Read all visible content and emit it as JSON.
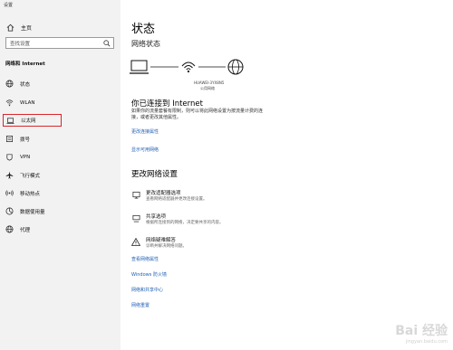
{
  "window": {
    "title": "设置"
  },
  "sidebar": {
    "home_label": "主页",
    "search_placeholder": "查找设置",
    "section_title": "网络和 Internet",
    "items": [
      {
        "label": "状态",
        "icon": "status-globe-icon"
      },
      {
        "label": "WLAN",
        "icon": "wifi-icon"
      },
      {
        "label": "以太网",
        "icon": "ethernet-icon",
        "active": true
      },
      {
        "label": "拨号",
        "icon": "dialup-icon"
      },
      {
        "label": "VPN",
        "icon": "vpn-icon"
      },
      {
        "label": "飞行模式",
        "icon": "airplane-icon"
      },
      {
        "label": "移动热点",
        "icon": "hotspot-icon"
      },
      {
        "label": "数据使用量",
        "icon": "data-usage-icon"
      },
      {
        "label": "代理",
        "icon": "proxy-globe-icon"
      }
    ]
  },
  "main": {
    "title": "状态",
    "network_status_title": "网络状态",
    "network_name": "HUAWEI-3YX8N5",
    "network_type": "公用网络",
    "connected_title": "你已连接到 Internet",
    "connected_desc": "如果你的流量套餐有限制，则可以将此网络设置为按流量计费的连接，或者更改其他属性。",
    "link_change_props": "更改连接属性",
    "link_show_networks": "显示可用网络",
    "change_settings_title": "更改网络设置",
    "options": [
      {
        "title": "更改适配器选项",
        "desc": "查看网络适配器并更改连接设置。",
        "icon": "adapter-icon"
      },
      {
        "title": "共享选项",
        "desc": "根据所连接到的网络，决定要共享的内容。",
        "icon": "sharing-icon"
      },
      {
        "title": "网络疑难解答",
        "desc": "诊断并解决网络问题。",
        "icon": "warning-icon"
      }
    ],
    "links_bottom": [
      "查看网络属性",
      "Windows 防火墙",
      "网络和共享中心",
      "网络重置"
    ]
  },
  "watermark": {
    "text": "Bai 经验",
    "sub": "jingyan.baidu.com"
  }
}
